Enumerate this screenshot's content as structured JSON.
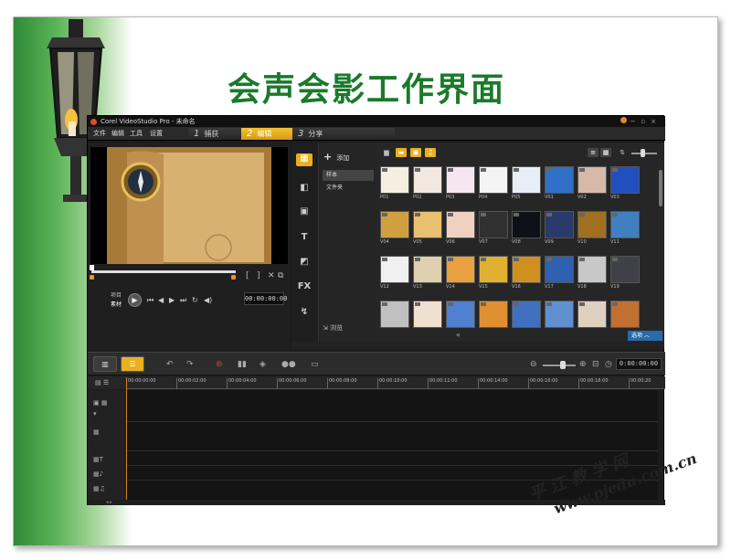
{
  "slide": {
    "title": "会声会影工作界面",
    "watermark_cn": "平江教学网",
    "watermark_url": "www.pjedu.com.cn"
  },
  "app": {
    "window_title": "Corel VideoStudio Pro - 未命名",
    "menu": [
      "文件",
      "编辑",
      "工具",
      "设置"
    ],
    "steps": [
      {
        "num": "1",
        "label": "捕获",
        "active": false
      },
      {
        "num": "2",
        "label": "编辑",
        "active": true
      },
      {
        "num": "3",
        "label": "分享",
        "active": false
      }
    ]
  },
  "preview": {
    "mode_project": "项目",
    "mode_clip": "素材",
    "timecode": "00:00:00:00",
    "bracket_in": "[",
    "bracket_out": "]"
  },
  "library": {
    "add_label": "添加",
    "folders": [
      "样本",
      "文件夹"
    ],
    "browse_label": "浏览",
    "options_label": "选项",
    "tools": [
      "media-icon",
      "transition-icon",
      "graphic-icon",
      "T",
      "filter-icon",
      "FX",
      "path-icon"
    ],
    "thumbnails": [
      {
        "label": "P01",
        "color": "#f4efe0"
      },
      {
        "label": "P02",
        "color": "#f2e8e0"
      },
      {
        "label": "P03",
        "color": "#f6e6f0"
      },
      {
        "label": "P04",
        "color": "#f4f4f4"
      },
      {
        "label": "P05",
        "color": "#e8eef8"
      },
      {
        "label": "V01",
        "color": "#2f6fc8"
      },
      {
        "label": "V02",
        "color": "#d8b8a8"
      },
      {
        "label": "V03",
        "color": "#2050c0"
      },
      {
        "label": "V04",
        "color": "#d0a040"
      },
      {
        "label": "V05",
        "color": "#e8c070"
      },
      {
        "label": "V06",
        "color": "#f0d0c0"
      },
      {
        "label": "V07",
        "color": "#303030"
      },
      {
        "label": "V08",
        "color": "#101018"
      },
      {
        "label": "V09",
        "color": "#2a3a6a"
      },
      {
        "label": "V10",
        "color": "#a07020"
      },
      {
        "label": "V11",
        "color": "#4080c0"
      },
      {
        "label": "V12",
        "color": "#f0f0f0"
      },
      {
        "label": "V13",
        "color": "#e0d0b0"
      },
      {
        "label": "V14",
        "color": "#e8a040"
      },
      {
        "label": "V15",
        "color": "#e0b030"
      },
      {
        "label": "V16",
        "color": "#d09020"
      },
      {
        "label": "V17",
        "color": "#3060b0"
      },
      {
        "label": "V18",
        "color": "#c8c8c8"
      },
      {
        "label": "V19",
        "color": "#404048"
      },
      {
        "label": "",
        "color": "#c0c0c0"
      },
      {
        "label": "",
        "color": "#f0e0d0"
      },
      {
        "label": "",
        "color": "#5080d0"
      },
      {
        "label": "",
        "color": "#e09030"
      },
      {
        "label": "",
        "color": "#4070c0"
      },
      {
        "label": "",
        "color": "#6090d0"
      },
      {
        "label": "",
        "color": "#e0d0c0"
      },
      {
        "label": "",
        "color": "#c07030"
      }
    ]
  },
  "timeline": {
    "timecode": "0:00:00:00",
    "ruler": [
      "00:00:00:00",
      "00:00:02:00",
      "00:00:04:00",
      "00:00:06:00",
      "00:00:08:00",
      "00:00:10:00",
      "00:00:12:00",
      "00:00:14:00",
      "00:00:16:00",
      "00:00:18:00",
      "00:00:20"
    ]
  },
  "colors": {
    "accent": "#e8b020",
    "title_green": "#1a7a2a",
    "options_blue": "#2a6aa8"
  }
}
